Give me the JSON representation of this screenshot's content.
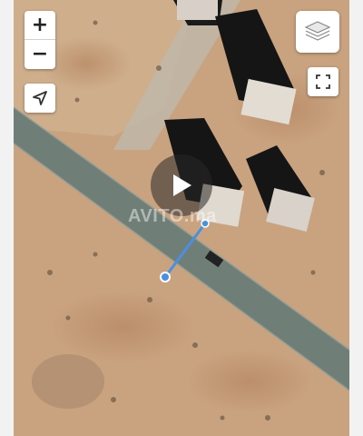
{
  "map": {
    "zoom_in_label": "+",
    "zoom_out_label": "−",
    "locate_icon": "navigation-arrow-icon",
    "layers_icon": "layers-stack-icon",
    "fullscreen_icon": "fullscreen-corners-icon",
    "play_icon": "play-icon",
    "watermark": "AVITO.ma",
    "colors": {
      "ground": "#c9a27f",
      "road": "#6f7f78",
      "marker": "#4a90e2",
      "control_bg": "#ffffff"
    }
  }
}
